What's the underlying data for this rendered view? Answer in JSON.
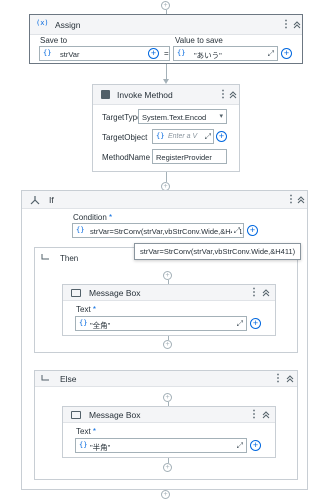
{
  "assign": {
    "title": "Assign",
    "save_to_label": "Save to",
    "value_label": "Value to save",
    "save_to_value": "strVar",
    "equals": "=",
    "value_value": "\"あいう\""
  },
  "invoke": {
    "title": "Invoke Method",
    "target_type_label": "TargetType",
    "target_type_value": "System.Text.Encod",
    "target_object_label": "TargetObject",
    "target_object_placeholder": "Enter a V",
    "method_name_label": "MethodName",
    "method_name_value": "RegisterProvider"
  },
  "if": {
    "title": "If",
    "condition_label": "Condition",
    "condition_value": "strVar=StrConv(strVar,vbStrConv.Wide,&H411)",
    "tooltip": "strVar=StrConv(strVar,vbStrConv.Wide,&H411)"
  },
  "then": {
    "title": "Then",
    "msgbox_title": "Message Box",
    "text_label": "Text",
    "text_value": "\"全角\""
  },
  "else": {
    "title": "Else",
    "msgbox_title": "Message Box",
    "text_label": "Text",
    "text_value": "\"半角\""
  },
  "required_marker": "*",
  "colors": {
    "accent": "#0067df",
    "border": "#c8ced4",
    "header": "#f4f5f7"
  }
}
